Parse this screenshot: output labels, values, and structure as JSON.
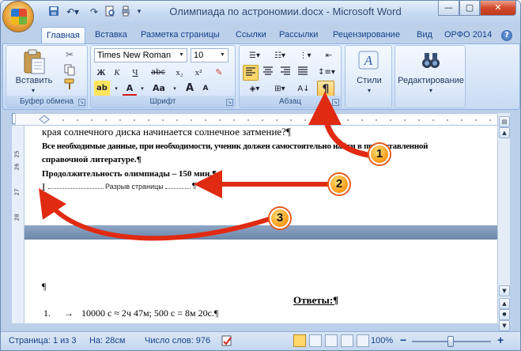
{
  "window": {
    "title": "Олимпиада по астрономии.docx - Microsoft Word"
  },
  "tabs": [
    "Главная",
    "Вставка",
    "Разметка страницы",
    "Ссылки",
    "Рассылки",
    "Рецензирование",
    "Вид",
    "ОРФО 2014"
  ],
  "groups": {
    "clipboard": {
      "label": "Буфер обмена",
      "paste_label": "Вставить"
    },
    "font": {
      "label": "Шрифт",
      "font_name": "Times New Roman",
      "font_size": "10",
      "bold": "Ж",
      "italic": "К",
      "underline": "Ч",
      "strike": "abc",
      "subscript": "x₂",
      "superscript": "x²",
      "case": "Аа",
      "grow": "A",
      "shrink": "A"
    },
    "paragraph": {
      "label": "Абзац",
      "show_marks": "¶"
    },
    "styles": {
      "label": "Стили"
    },
    "editing": {
      "label": "Редактирование"
    }
  },
  "document": {
    "lines": [
      "края солнечного диска начинается солнечное затмение?¶",
      "Все необходимые данные, при необходимости, ученик должен самостоятельно найти в предоставленной",
      "справочной литературе.¶",
      "Продолжительность олимпиады – 150 мин.¶"
    ],
    "page_break": "Разрыв страницы",
    "page_break_mark": "¶",
    "cursor": "I",
    "para_mark": "¶",
    "answers_heading": "Ответы:¶",
    "last_line_num": "1.",
    "last_line": "10000 с ≈ 2ч 47м; 500 с = 8м 20с.¶"
  },
  "ruler_left_marks": [
    "25",
    "26",
    "27",
    "28"
  ],
  "callouts": [
    "1",
    "2",
    "3"
  ],
  "status": {
    "page": "Страница: 1 из 3",
    "position": "На: 28см",
    "words": "Число слов: 976",
    "zoom": "100%"
  },
  "colors": {
    "callout": "#ff9c1b",
    "arrow": "#e02a12",
    "accent": "#15428b"
  }
}
